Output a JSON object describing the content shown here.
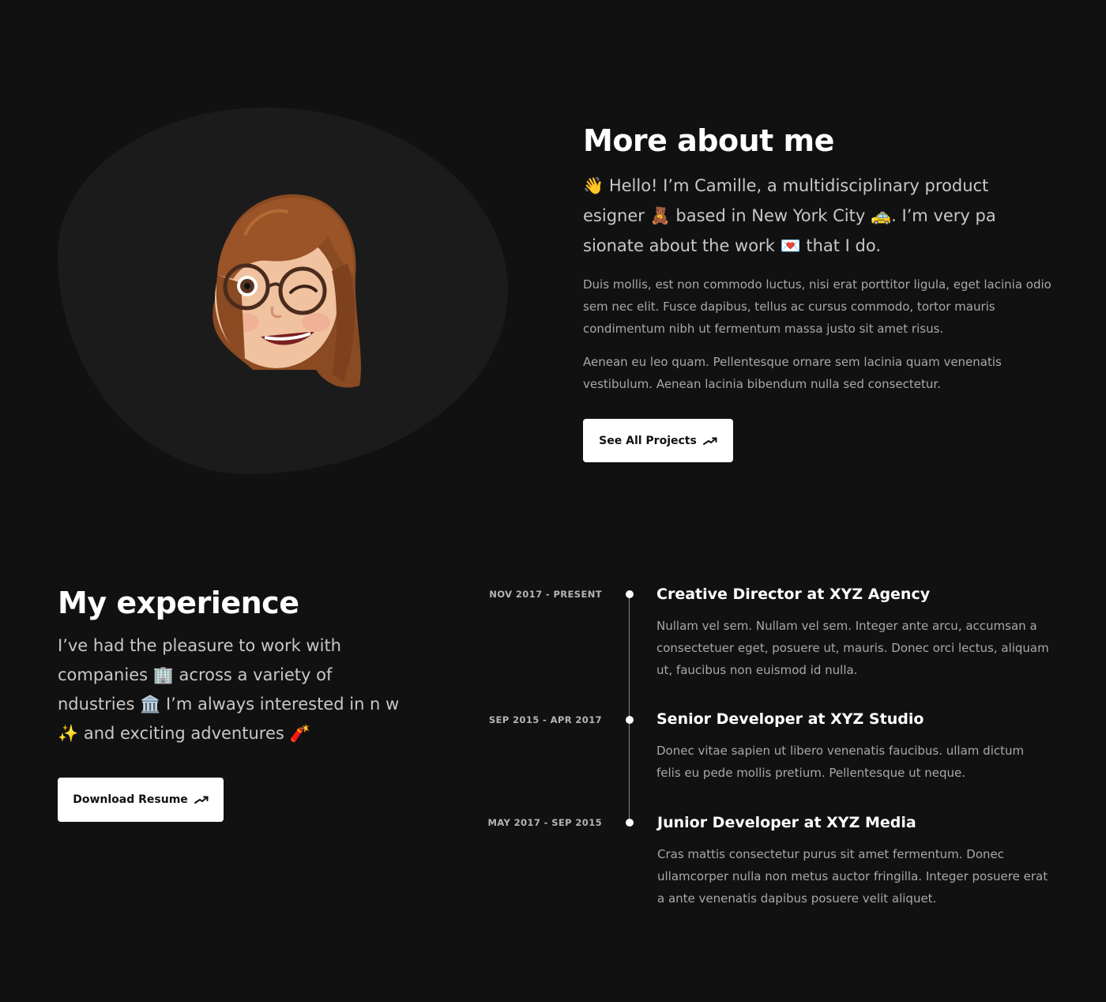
{
  "about": {
    "title": "More about me",
    "lead": "👋 Hello! I’m Camille, a multidisciplinary product esigner 🧸 based in New York City 🚕. I’m very pa sionate about the work 💌 that I do.",
    "para1": "Duis mollis, est non commodo luctus, nisi erat porttitor ligula, eget lacinia odio sem nec elit. Fusce dapibus, tellus ac cursus commodo, tortor mauris condimentum nibh ut fermentum massa justo sit amet risus.",
    "para2": "Aenean eu leo quam. Pellentesque ornare sem lacinia quam venenatis vestibulum. Aenean lacinia bibendum nulla sed consectetur.",
    "button_label": "See All Projects"
  },
  "experience": {
    "title": "My experience",
    "lead": "I’ve had the pleasure to work with companies 🏢 across a variety of ndustries 🏛️ I’m always interested in n w ✨ and exciting adventures 🧨",
    "button_label": "Download Resume",
    "jobs": [
      {
        "date": "NOV 2017 - PRESENT",
        "title": "Creative Director at XYZ Agency",
        "desc": "Nullam vel sem. Nullam vel sem. Integer ante arcu, accumsan a consectetuer eget, posuere ut, mauris. Donec orci lectus, aliquam ut, faucibus non euismod id nulla."
      },
      {
        "date": "SEP 2015 - APR 2017",
        "title": "Senior Developer at XYZ Studio",
        "desc": "Donec vitae sapien ut libero venenatis faucibus. ullam dictum felis eu pede mollis pretium. Pellentesque ut neque."
      },
      {
        "date": "MAY 2017 - SEP 2015",
        "title": "Junior Developer at XYZ Media",
        "desc": "Cras mattis consectetur purus sit amet fermentum. Donec ullamcorper nulla non metus auctor fringilla. Integer posuere erat a ante venenatis dapibus posuere velit aliquet."
      }
    ]
  },
  "icons": {
    "arrow": "arrow-up-right-icon",
    "avatar": "memoji-avatar"
  },
  "colors": {
    "background": "#111111",
    "blob": "#1b1b1b",
    "button_bg": "#ffffff",
    "text_muted": "#a8a8a8"
  }
}
